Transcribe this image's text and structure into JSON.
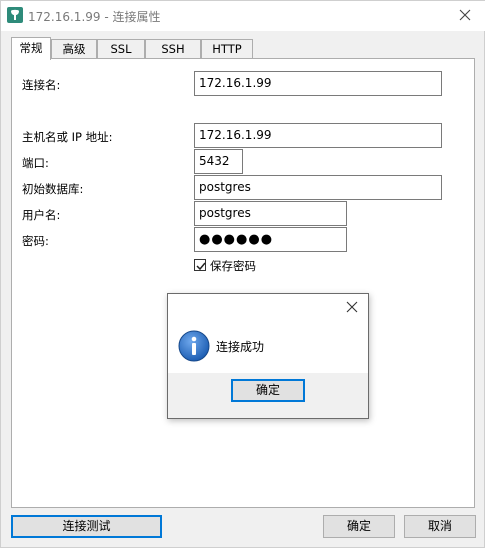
{
  "window": {
    "title": "172.16.1.99 - 连接属性"
  },
  "tabs": [
    {
      "label": "常规"
    },
    {
      "label": "高级"
    },
    {
      "label": "SSL"
    },
    {
      "label": "SSH"
    },
    {
      "label": "HTTP"
    }
  ],
  "form": {
    "connection_name": {
      "label": "连接名:",
      "value": "172.16.1.99"
    },
    "host": {
      "label": "主机名或 IP 地址:",
      "value": "172.16.1.99"
    },
    "port": {
      "label": "端口:",
      "value": "5432"
    },
    "initial_db": {
      "label": "初始数据库:",
      "value": "postgres"
    },
    "username": {
      "label": "用户名:",
      "value": "postgres"
    },
    "password": {
      "label": "密码:",
      "value": "●●●●●●"
    },
    "save_password": {
      "label": "保存密码",
      "checked": true
    }
  },
  "dialog": {
    "message": "连接成功",
    "ok_label": "确定"
  },
  "footer": {
    "test_label": "连接测试",
    "ok_label": "确定",
    "cancel_label": "取消"
  },
  "colors": {
    "accent": "#0078d7",
    "info_blue": "#1e5fb4"
  }
}
